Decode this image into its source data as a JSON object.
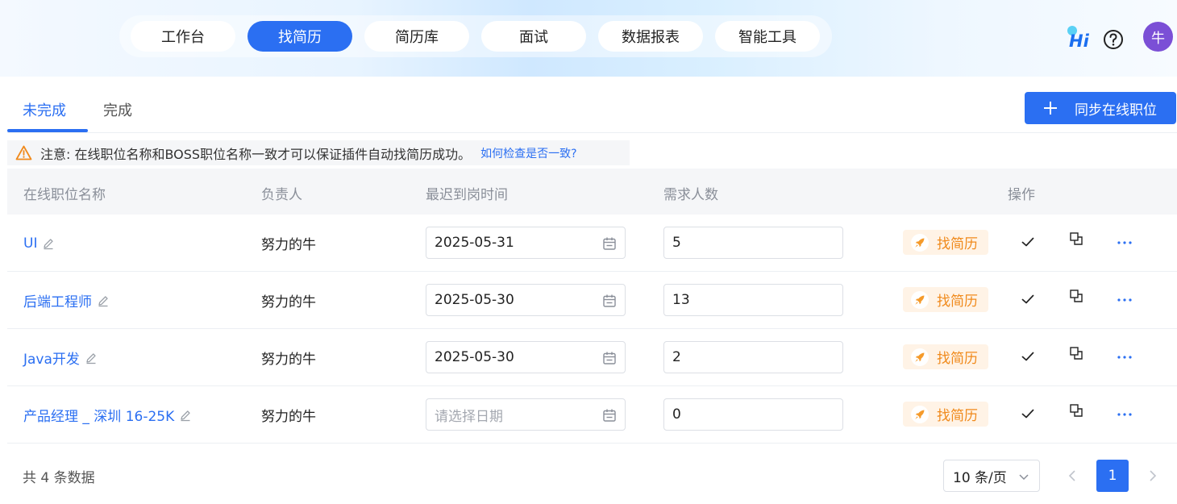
{
  "nav": {
    "tabs": [
      {
        "label": "工作台"
      },
      {
        "label": "找简历"
      },
      {
        "label": "简历库"
      },
      {
        "label": "面试"
      },
      {
        "label": "数据报表"
      },
      {
        "label": "智能工具"
      }
    ],
    "active_tab": "找简历",
    "hi_logo_text": "Hi",
    "avatar_text": "牛"
  },
  "subtabs": {
    "items": [
      {
        "label": "未完成"
      },
      {
        "label": "完成"
      }
    ],
    "active": "未完成"
  },
  "sync_button_label": "同步在线职位",
  "notice": {
    "text": "注意:  在线职位名称和BOSS职位名称一致才可以保证插件自动找简历成功。",
    "link": "如何检查是否一致?"
  },
  "table": {
    "headers": {
      "name": "在线职位名称",
      "owner": "负责人",
      "date": "最迟到岗时间",
      "count": "需求人数",
      "actions": "操作"
    },
    "date_placeholder": "请选择日期",
    "find_label": "找简历",
    "rows": [
      {
        "name": "UI",
        "owner": "努力的牛",
        "date": "2025-05-31",
        "count": "5"
      },
      {
        "name": "后端工程师",
        "owner": "努力的牛",
        "date": "2025-05-30",
        "count": "13"
      },
      {
        "name": "Java开发",
        "owner": "努力的牛",
        "date": "2025-05-30",
        "count": "2"
      },
      {
        "name": "产品经理 _ 深圳 16-25K",
        "owner": "努力的牛",
        "date": "",
        "count": "0"
      }
    ]
  },
  "footer": {
    "total": "共 4 条数据",
    "page_size": "10 条/页",
    "current_page": "1"
  },
  "colors": {
    "primary": "#2b6ff2",
    "find_bg": "#fff3e6",
    "find_text": "#f08a1c",
    "avatar_bg": "#7b4fd6",
    "warning": "#f08a1c"
  }
}
